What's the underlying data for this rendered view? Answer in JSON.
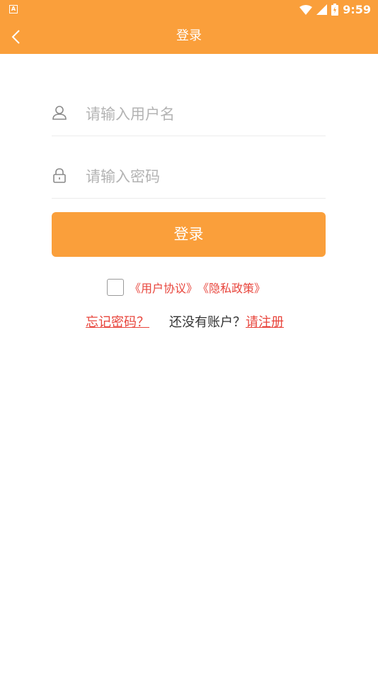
{
  "status_bar": {
    "time": "9:59",
    "app_icon_text": "A"
  },
  "app_bar": {
    "title": "登录",
    "back_icon": "chevron-left-icon"
  },
  "form": {
    "username": {
      "placeholder": "请输入用户名",
      "value": "",
      "icon": "user-icon"
    },
    "password": {
      "placeholder": "请输入密码",
      "value": "",
      "icon": "lock-icon"
    },
    "login_label": "登录"
  },
  "agreement": {
    "user_agreement": "《用户协议》",
    "privacy_policy": "《隐私政策》",
    "checked": false
  },
  "links": {
    "forgot": "忘记密码？",
    "no_account": "还没有账户？",
    "register": "请注册"
  },
  "colors": {
    "accent": "#fa9f3b",
    "link": "#e8453c"
  }
}
